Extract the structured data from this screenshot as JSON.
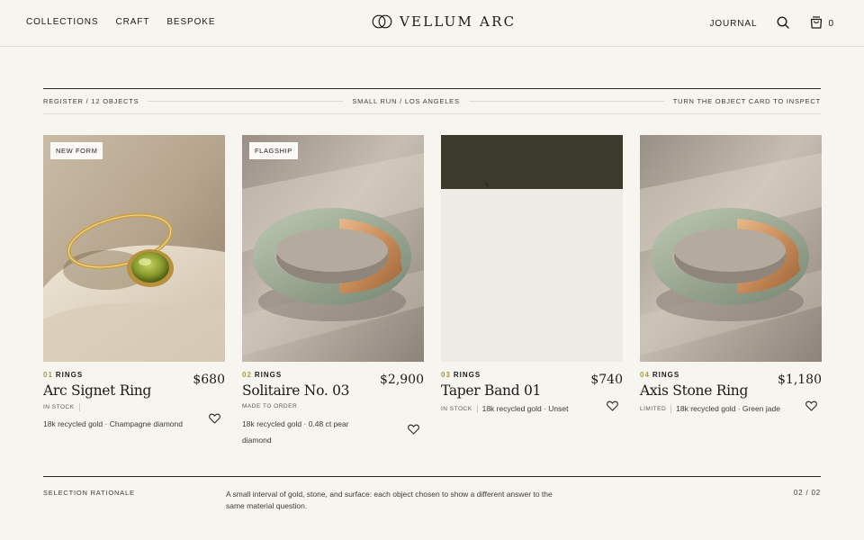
{
  "header": {
    "nav_left": [
      "COLLECTIONS",
      "CRAFT",
      "BESPOKE"
    ],
    "logo_text": "VELLUM ARC",
    "journal": "JOURNAL",
    "cart_count": "0"
  },
  "register": {
    "left": "REGISTER / 12 OBJECTS",
    "center": "SMALL RUN / LOS ANGELES",
    "right": "TURN THE OBJECT CARD TO INSPECT"
  },
  "products": [
    {
      "badge": "NEW FORM",
      "num": "01",
      "category": "RINGS",
      "name": "Arc Signet Ring",
      "price": "$680",
      "status": "IN STOCK",
      "spec": "18k recycled gold · Champagne diamond",
      "image": "peridot-gold-ring"
    },
    {
      "badge": "FLAGSHIP",
      "num": "02",
      "category": "RINGS",
      "name": "Solitaire No. 03",
      "price": "$2,900",
      "status": "MADE TO ORDER",
      "spec": "18k recycled gold · 0.48 ct pear diamond",
      "image": "jade-gold-band"
    },
    {
      "badge": "",
      "num": "03",
      "category": "RINGS",
      "name": "Taper Band 01",
      "price": "$740",
      "status": "IN STOCK",
      "spec": "18k recycled gold · Unset",
      "image": "placeholder-loading"
    },
    {
      "badge": "",
      "num": "04",
      "category": "RINGS",
      "name": "Axis Stone Ring",
      "price": "$1,180",
      "status": "LIMITED",
      "spec": "18k recycled gold · Green jade",
      "image": "jade-gold-band"
    }
  ],
  "rationale": {
    "label": "SELECTION RATIONALE",
    "text": "A small interval of gold, stone, and surface: each object chosen to show a different answer to the same material question.",
    "page": "02 / 02"
  },
  "colors": {
    "background": "#f7f5f0",
    "accent_number": "#a89a42",
    "ink": "#1c1b19"
  }
}
